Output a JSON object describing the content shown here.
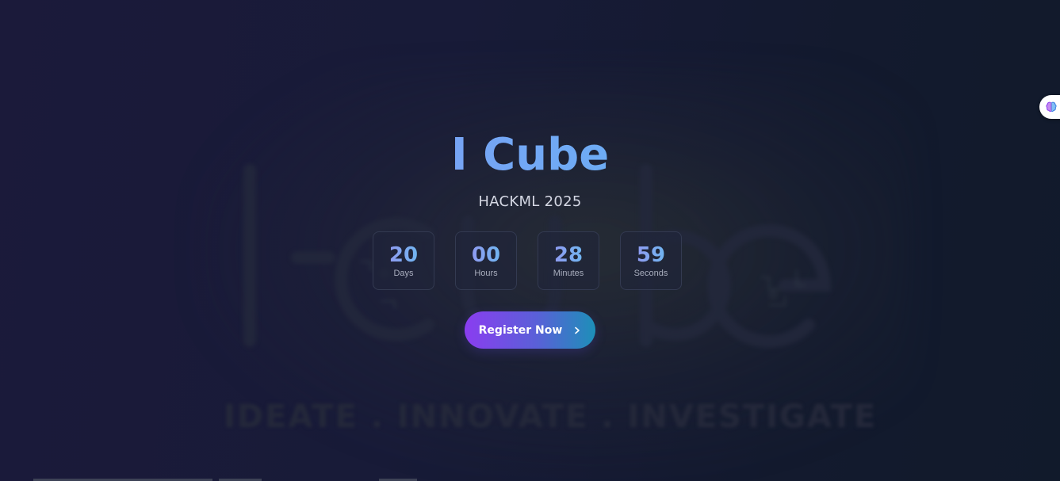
{
  "hero": {
    "title": "I Cube",
    "subtitle": "HACKML 2025"
  },
  "background": {
    "logo_text": "i-cube",
    "tagline": "IDEATE . INNOVATE . INVESTIGATE"
  },
  "countdown": [
    {
      "value": "20",
      "label": "Days"
    },
    {
      "value": "00",
      "label": "Hours"
    },
    {
      "value": "28",
      "label": "Minutes"
    },
    {
      "value": "59",
      "label": "Seconds"
    }
  ],
  "cta": {
    "label": "Register Now",
    "icon": "chevron-right-icon"
  },
  "side_widget": {
    "icon": "brain-icon"
  },
  "colors": {
    "background": "#181b38",
    "accent_purple": "#8a3df0",
    "accent_blue": "#1d8fb8",
    "title_gradient_start": "#8e88f0",
    "title_gradient_end": "#55c1f0"
  }
}
